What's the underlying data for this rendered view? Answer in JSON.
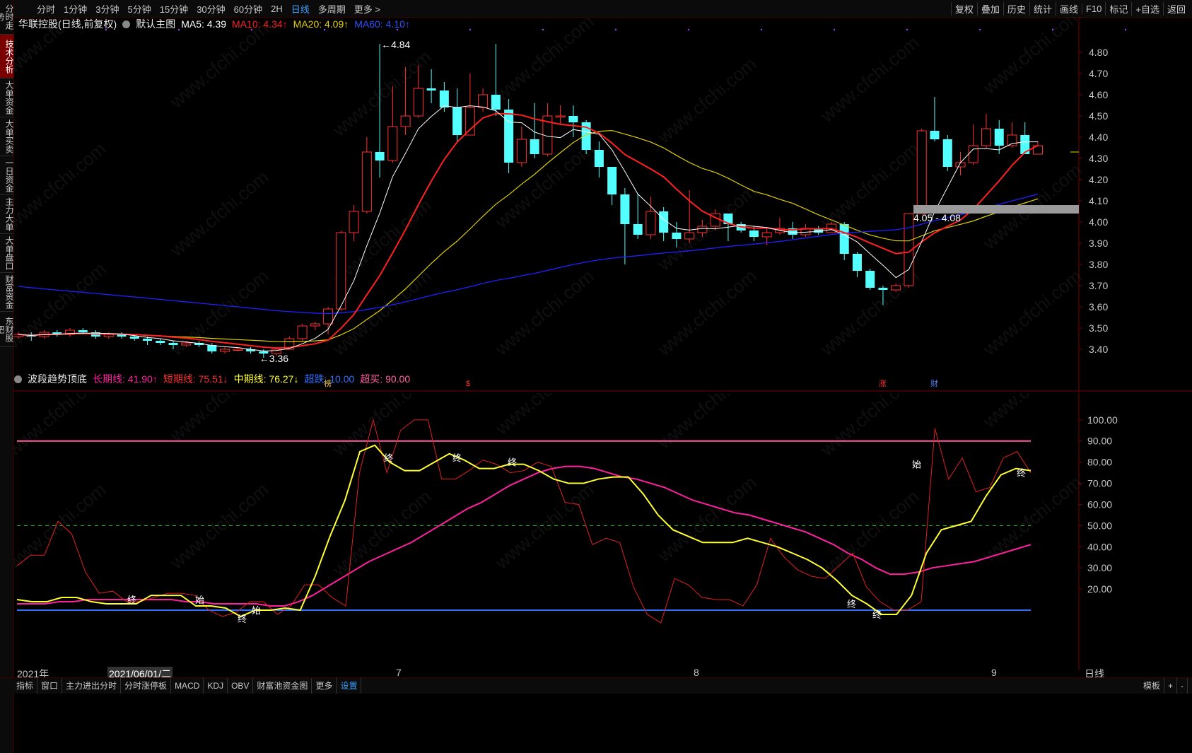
{
  "toolbar": {
    "periods": [
      "分时",
      "1分钟",
      "3分钟",
      "5分钟",
      "15分钟",
      "30分钟",
      "60分钟",
      "2H",
      "日线",
      "多周期",
      "更多 >"
    ],
    "active_period": "日线",
    "right_tools": [
      "复权",
      "叠加",
      "历史",
      "统计",
      "画线",
      "F10",
      "标记",
      "+自选",
      "返回"
    ]
  },
  "left_tabs": [
    "分时走势",
    "技术分析",
    "大单资金",
    "大单买卖",
    "一日资金",
    "主力大单",
    "大单盘口",
    "财富资金",
    "东财股吧"
  ],
  "active_left_tab": "技术分析",
  "main_legend": {
    "stock": "华联控股(日线,前复权)",
    "indicator": "默认主图",
    "ma5": "MA5: 4.39",
    "ma10": "MA10: 4.34↑",
    "ma20": "MA20: 4.09↑",
    "ma60": "MA60: 4.10↑"
  },
  "annotations": {
    "high": "4.84",
    "low": "3.36",
    "range_box": "4.05 - 4.08",
    "markers": [
      "榜",
      "$",
      "涨",
      "财"
    ]
  },
  "osc_legend": {
    "title": "波段趋势顶底",
    "long": "长期线: 41.90↑",
    "short": "短期线: 75.51↓",
    "mid": "中期线: 76.27↓",
    "oversold": "超跌: 10.00",
    "overbought": "超买: 90.00"
  },
  "osc_labels": {
    "start": "始",
    "end": "终"
  },
  "date_axis": {
    "year": "2021年",
    "cursor": "2021/06/01/二",
    "months": [
      "7",
      "8",
      "9"
    ],
    "period_label": "日线"
  },
  "bottom_tabs": [
    "指标",
    "窗口",
    "主力进出分时",
    "分时涨停板",
    "MACD",
    "KDJ",
    "OBV",
    "财富池资金图",
    "更多",
    "设置"
  ],
  "bottom_right": [
    "模板",
    "+",
    "-"
  ],
  "watermark": "www.cfchi.com",
  "colors": {
    "up": "#ff3030",
    "down": "#54ffff",
    "ma5": "#ffffff",
    "ma10": "#ff2020",
    "ma20": "#e0d000",
    "ma60": "#2020ff",
    "long": "#ff20a0",
    "short": "#e02020",
    "mid": "#ffff30",
    "oversold": "#3070ff",
    "overbought": "#ff60a0"
  },
  "chart_data": [
    {
      "type": "candlestick",
      "ylim": [
        3.36,
        4.84
      ],
      "yticks": [
        3.4,
        3.5,
        3.6,
        3.7,
        3.8,
        3.9,
        4.0,
        4.1,
        4.2,
        4.3,
        4.4,
        4.5,
        4.6,
        4.7,
        4.8
      ],
      "candles": [
        [
          3.46,
          3.47,
          3.45,
          3.48
        ],
        [
          3.47,
          3.46,
          3.44,
          3.48
        ],
        [
          3.46,
          3.48,
          3.45,
          3.49
        ],
        [
          3.48,
          3.47,
          3.46,
          3.49
        ],
        [
          3.47,
          3.49,
          3.46,
          3.5
        ],
        [
          3.49,
          3.48,
          3.47,
          3.5
        ],
        [
          3.48,
          3.46,
          3.45,
          3.49
        ],
        [
          3.46,
          3.47,
          3.45,
          3.48
        ],
        [
          3.47,
          3.46,
          3.45,
          3.48
        ],
        [
          3.46,
          3.45,
          3.44,
          3.47
        ],
        [
          3.45,
          3.44,
          3.42,
          3.46
        ],
        [
          3.44,
          3.43,
          3.42,
          3.45
        ],
        [
          3.43,
          3.42,
          3.4,
          3.44
        ],
        [
          3.42,
          3.43,
          3.41,
          3.44
        ],
        [
          3.43,
          3.42,
          3.41,
          3.44
        ],
        [
          3.42,
          3.39,
          3.38,
          3.43
        ],
        [
          3.39,
          3.4,
          3.38,
          3.41
        ],
        [
          3.4,
          3.4,
          3.39,
          3.41
        ],
        [
          3.4,
          3.39,
          3.38,
          3.41
        ],
        [
          3.39,
          3.38,
          3.36,
          3.4
        ],
        [
          3.38,
          3.4,
          3.37,
          3.41
        ],
        [
          3.4,
          3.45,
          3.4,
          3.46
        ],
        [
          3.45,
          3.51,
          3.44,
          3.52
        ],
        [
          3.51,
          3.52,
          3.49,
          3.53
        ],
        [
          3.52,
          3.59,
          3.47,
          3.6
        ],
        [
          3.59,
          3.95,
          3.58,
          3.96
        ],
        [
          3.95,
          4.05,
          3.91,
          4.08
        ],
        [
          4.05,
          4.33,
          4.04,
          4.4
        ],
        [
          4.33,
          4.29,
          4.21,
          4.84
        ],
        [
          4.29,
          4.45,
          4.28,
          4.64
        ],
        [
          4.45,
          4.5,
          4.41,
          4.73
        ],
        [
          4.5,
          4.63,
          4.49,
          4.74
        ],
        [
          4.63,
          4.62,
          4.56,
          4.72
        ],
        [
          4.62,
          4.54,
          4.52,
          4.66
        ],
        [
          4.54,
          4.41,
          4.38,
          4.63
        ],
        [
          4.41,
          4.54,
          4.41,
          4.7
        ],
        [
          4.54,
          4.6,
          4.52,
          4.63
        ],
        [
          4.6,
          4.53,
          4.5,
          4.84
        ],
        [
          4.53,
          4.28,
          4.23,
          4.58
        ],
        [
          4.28,
          4.39,
          4.26,
          4.45
        ],
        [
          4.39,
          4.32,
          4.3,
          4.56
        ],
        [
          4.32,
          4.5,
          4.31,
          4.56
        ],
        [
          4.5,
          4.5,
          4.46,
          4.55
        ],
        [
          4.5,
          4.47,
          4.4,
          4.55
        ],
        [
          4.47,
          4.34,
          4.32,
          4.48
        ],
        [
          4.34,
          4.26,
          4.21,
          4.38
        ],
        [
          4.26,
          4.13,
          4.08,
          4.26
        ],
        [
          4.13,
          3.99,
          3.8,
          4.16
        ],
        [
          3.99,
          3.94,
          3.92,
          4.13
        ],
        [
          3.94,
          4.05,
          3.92,
          4.12
        ],
        [
          4.05,
          3.95,
          3.91,
          4.07
        ],
        [
          3.95,
          3.92,
          3.88,
          4.0
        ],
        [
          3.92,
          3.95,
          3.9,
          4.15
        ],
        [
          3.95,
          3.98,
          3.93,
          4.01
        ],
        [
          3.98,
          4.04,
          3.96,
          4.06
        ],
        [
          4.04,
          3.99,
          3.91,
          4.04
        ],
        [
          3.99,
          3.96,
          3.95,
          4.0
        ],
        [
          3.96,
          3.93,
          3.91,
          3.98
        ],
        [
          3.93,
          3.95,
          3.89,
          3.97
        ],
        [
          3.95,
          3.97,
          3.94,
          4.02
        ],
        [
          3.97,
          3.94,
          3.92,
          4.0
        ],
        [
          3.94,
          3.97,
          3.93,
          3.99
        ],
        [
          3.97,
          3.95,
          3.94,
          3.98
        ],
        [
          3.95,
          3.99,
          3.95,
          4.0
        ],
        [
          3.99,
          3.85,
          3.82,
          4.0
        ],
        [
          3.85,
          3.77,
          3.74,
          3.86
        ],
        [
          3.77,
          3.69,
          3.68,
          3.78
        ],
        [
          3.69,
          3.68,
          3.61,
          3.7
        ],
        [
          3.68,
          3.7,
          3.67,
          3.71
        ],
        [
          3.7,
          4.04,
          3.69,
          4.04
        ],
        [
          4.04,
          4.43,
          4.16,
          4.44
        ],
        [
          4.43,
          4.39,
          4.38,
          4.59
        ],
        [
          4.39,
          4.26,
          4.24,
          4.41
        ],
        [
          4.26,
          4.28,
          4.22,
          4.33
        ],
        [
          4.28,
          4.36,
          4.27,
          4.46
        ],
        [
          4.36,
          4.44,
          4.35,
          4.51
        ],
        [
          4.44,
          4.36,
          4.32,
          4.48
        ],
        [
          4.36,
          4.41,
          4.35,
          4.47
        ],
        [
          4.41,
          4.32,
          4.32,
          4.47
        ],
        [
          4.32,
          4.36,
          4.32,
          4.38
        ]
      ]
    },
    {
      "type": "line",
      "ylim": [
        0,
        100
      ],
      "yticks": [
        20,
        30,
        40,
        50,
        60,
        70,
        80,
        90,
        100
      ],
      "series": [
        {
          "name": "长期线",
          "values": [
            13,
            13,
            13,
            14,
            14,
            15,
            15,
            15,
            15,
            15,
            15,
            15,
            14,
            14,
            13,
            13,
            13,
            13,
            12,
            12,
            14,
            17,
            21,
            25,
            29,
            33,
            36,
            39,
            42,
            46,
            50,
            54,
            58,
            61,
            65,
            69,
            72,
            75,
            77,
            78,
            78,
            77,
            75,
            73,
            72,
            70,
            68,
            65,
            62,
            60,
            58,
            56,
            55,
            53,
            51,
            49,
            47,
            44,
            41,
            37,
            34,
            30,
            27,
            27,
            28,
            30,
            31,
            32,
            33,
            35,
            37,
            39,
            41
          ]
        },
        {
          "name": "短期线",
          "values": [
            31,
            36,
            36,
            52,
            46,
            28,
            18,
            19,
            14,
            14,
            16,
            18,
            18,
            17,
            10,
            7,
            9,
            14,
            14,
            8,
            12,
            22,
            22,
            16,
            12,
            75,
            100,
            75,
            95,
            100,
            100,
            72,
            72,
            76,
            81,
            79,
            75,
            76,
            80,
            78,
            61,
            60,
            41,
            44,
            42,
            21,
            8,
            4,
            25,
            22,
            16,
            15,
            15,
            12,
            22,
            44,
            35,
            29,
            26,
            25,
            31,
            37,
            21,
            14,
            10,
            10,
            14,
            96,
            72,
            82,
            66,
            68,
            82,
            85,
            75
          ]
        },
        {
          "name": "中期线",
          "values": [
            15,
            14,
            14,
            16,
            16,
            14,
            13,
            13,
            13,
            17,
            17,
            17,
            12,
            12,
            11,
            7,
            10,
            10,
            11,
            10,
            26,
            45,
            62,
            85,
            88,
            80,
            76,
            76,
            80,
            84,
            81,
            77,
            77,
            79,
            79,
            76,
            72,
            70,
            70,
            72,
            73,
            73,
            65,
            55,
            48,
            45,
            42,
            42,
            42,
            44,
            42,
            40,
            37,
            34,
            30,
            24,
            17,
            13,
            8,
            8,
            17,
            37,
            48,
            50,
            52,
            64,
            74,
            77,
            76
          ]
        },
        {
          "name": "超跌",
          "values": [
            10
          ]
        },
        {
          "name": "超买",
          "values": [
            90
          ]
        }
      ]
    }
  ]
}
